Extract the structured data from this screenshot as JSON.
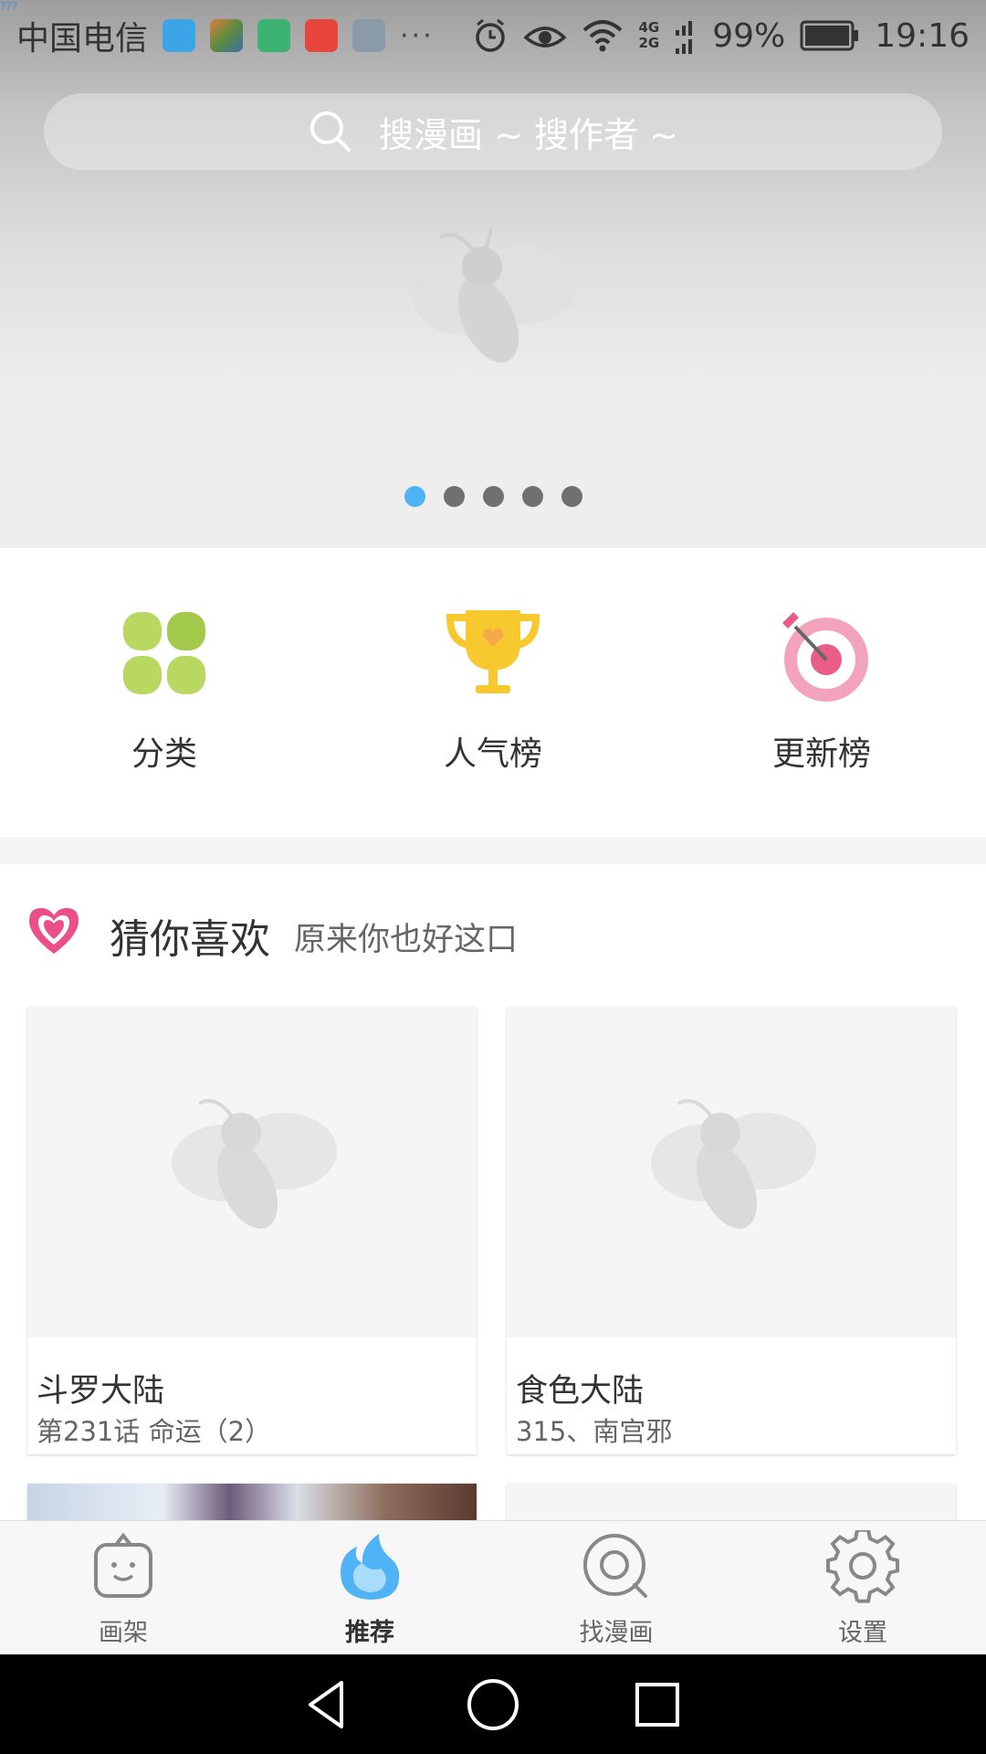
{
  "status_bar": {
    "tiny_indicator": "???",
    "carrier": "中国电信",
    "overflow": "···",
    "network_top": "4G",
    "network_bottom": "2G",
    "battery": "99%",
    "time": "19:16",
    "app_icons": [
      "ezui-app-icon",
      "photo-collage-app-icon",
      "wechat-app-icon",
      "huawei-app-icon",
      "gallery-app-icon"
    ]
  },
  "search": {
    "placeholder": "搜漫画 ~ 搜作者 ~"
  },
  "banner": {
    "page_count": 5,
    "active_index": 0
  },
  "quick_entries": [
    {
      "label": "分类",
      "icon": "category-icon"
    },
    {
      "label": "人气榜",
      "icon": "trophy-icon"
    },
    {
      "label": "更新榜",
      "icon": "target-icon"
    }
  ],
  "section": {
    "title": "猜你喜欢",
    "subtitle": "原来你也好这口"
  },
  "comics": [
    {
      "name": "斗罗大陆",
      "info": "第231话 命运（2）"
    },
    {
      "name": "食色大陆",
      "info": "315、南宫邪"
    }
  ],
  "bottom_nav": [
    {
      "label": "画架",
      "icon": "easel-icon",
      "active": false
    },
    {
      "label": "推荐",
      "icon": "recommend-flame-icon",
      "active": true
    },
    {
      "label": "找漫画",
      "icon": "find-comics-icon",
      "active": false
    },
    {
      "label": "设置",
      "icon": "settings-gear-icon",
      "active": false
    }
  ],
  "colors": {
    "accent_blue": "#4fb3f6",
    "category_green": "#b5d65a",
    "trophy_yellow": "#f7c92f",
    "target_pink": "#f29ab3"
  }
}
